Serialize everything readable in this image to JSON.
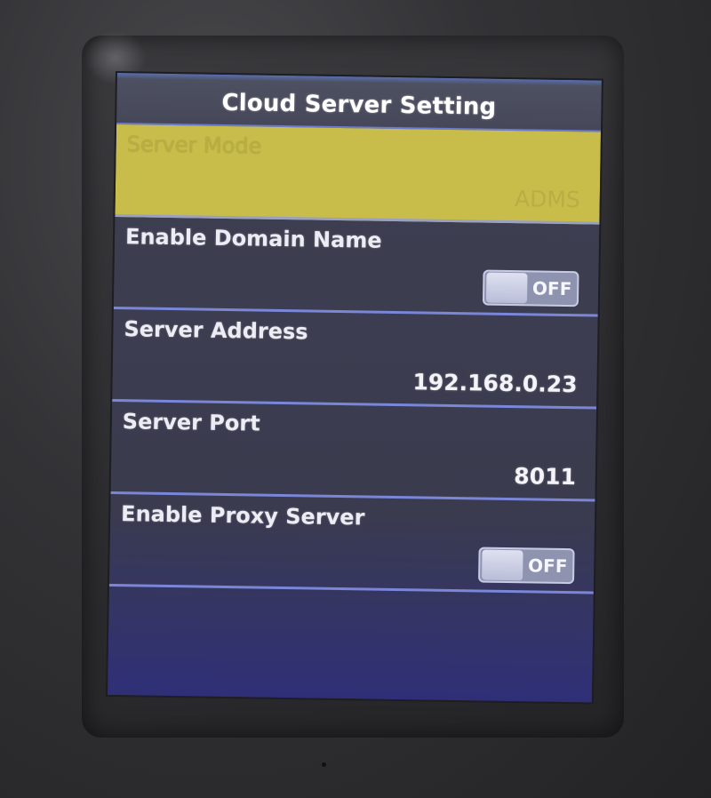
{
  "window": {
    "title": "Cloud Server Setting"
  },
  "settings": [
    {
      "label": "Server Mode",
      "value": "ADMS",
      "selected": true
    },
    {
      "label": "Enable Domain Name",
      "toggle": "OFF"
    },
    {
      "label": "Server Address",
      "value": "192.168.0.23"
    },
    {
      "label": "Server Port",
      "value": "8011"
    },
    {
      "label": "Enable Proxy Server",
      "toggle": "OFF"
    }
  ],
  "colors": {
    "selected_row": "#c8bc4a",
    "title_bar": "#46485a",
    "row_background": "#3e4052",
    "divider": "#7a86d8"
  }
}
